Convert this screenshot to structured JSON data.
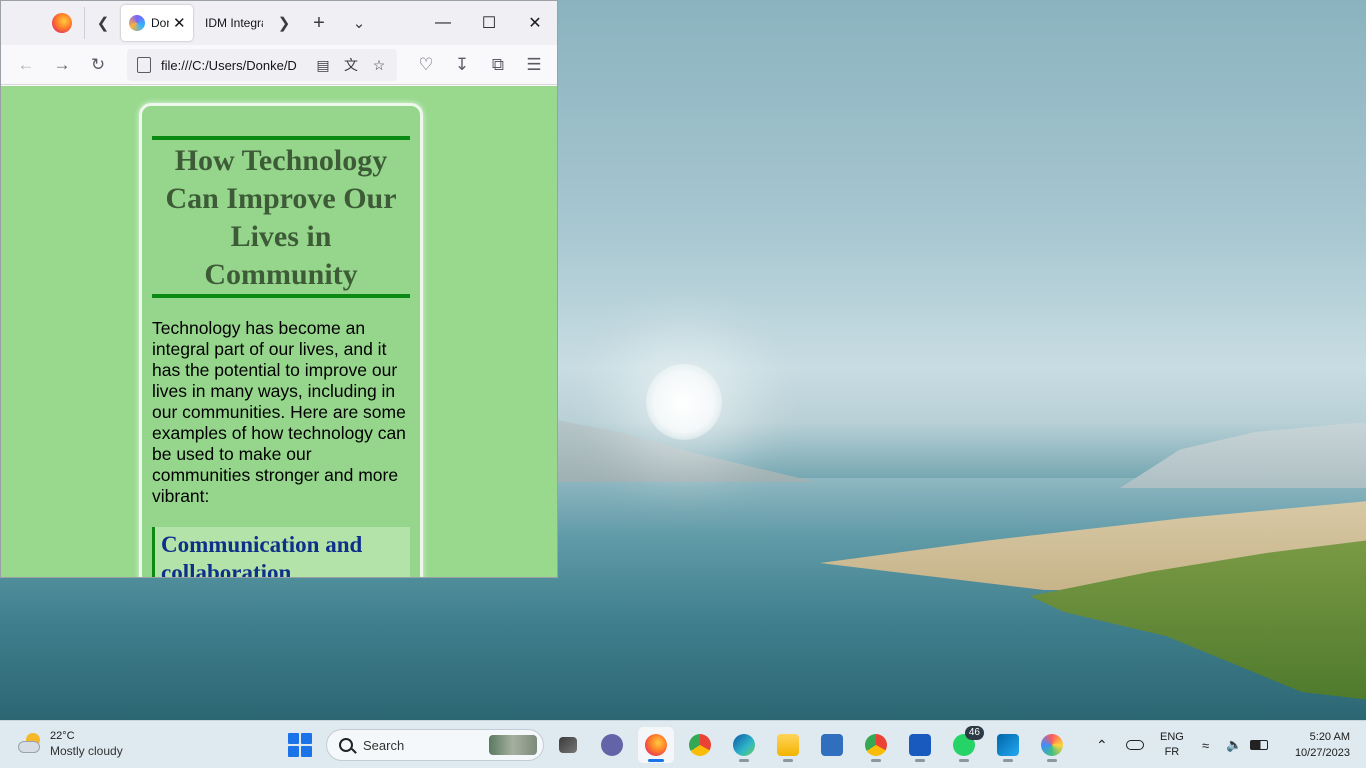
{
  "browser": {
    "tabs": [
      {
        "title": "Donke",
        "active": true
      },
      {
        "title": "IDM Integration",
        "active": false
      }
    ],
    "url": "file:///C:/Users/Donke/Desktop/index.html",
    "url_display": "file:///C:/Users/Donke/D",
    "icons": {
      "back": "arrow-left-icon",
      "forward": "arrow-right-icon",
      "reload": "reload-icon",
      "reader": "reader-view-icon",
      "translate": "translate-icon",
      "bookmark": "star-icon",
      "pocket": "pocket-icon",
      "downloads": "download-icon",
      "extensions": "puzzle-icon",
      "menu": "hamburger-menu-icon"
    }
  },
  "page": {
    "title": "How Technology Can Improve Our Lives in Community",
    "intro": "Technology has become an integral part of our lives, and it has the potential to improve our lives in many ways, including in our communities. Here are some examples of how technology can be used to make our communities stronger and more vibrant:",
    "sections": [
      {
        "heading": "Communication and collaboration"
      }
    ],
    "colors": {
      "background": "#98d98e",
      "title": "#3c5b36",
      "rule": "#0a8a12",
      "section_heading": "#0e2f8a"
    }
  },
  "taskbar": {
    "weather": {
      "temp": "22°C",
      "desc": "Mostly cloudy"
    },
    "search_placeholder": "Search",
    "apps": [
      {
        "name": "file-explorer-task-view"
      },
      {
        "name": "teams-chat"
      },
      {
        "name": "firefox",
        "active": true
      },
      {
        "name": "chrome"
      },
      {
        "name": "edge"
      },
      {
        "name": "file-explorer"
      },
      {
        "name": "microsoft-store"
      },
      {
        "name": "chrome-profile"
      },
      {
        "name": "word"
      },
      {
        "name": "whatsapp",
        "badge": "46"
      },
      {
        "name": "vscode"
      },
      {
        "name": "paint"
      }
    ],
    "language": {
      "lang": "ENG",
      "layout": "FR"
    },
    "time": "5:20 AM",
    "date": "10/27/2023"
  }
}
